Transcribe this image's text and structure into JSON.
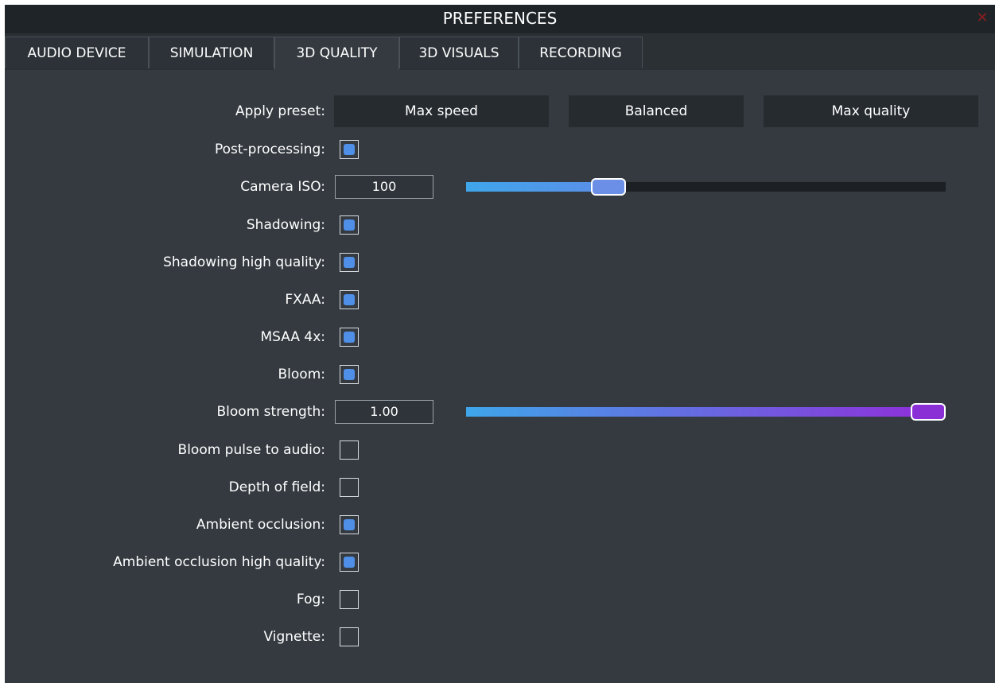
{
  "window": {
    "title": "PREFERENCES",
    "close_glyph": "✕"
  },
  "tabs": [
    {
      "label": "AUDIO DEVICE",
      "active": false
    },
    {
      "label": "SIMULATION",
      "active": false
    },
    {
      "label": "3D QUALITY",
      "active": true
    },
    {
      "label": "3D VISUALS",
      "active": false
    },
    {
      "label": "RECORDING",
      "active": false
    }
  ],
  "preset": {
    "label": "Apply preset:",
    "buttons": [
      "Max speed",
      "Balanced",
      "Max quality"
    ]
  },
  "settings": {
    "post_processing": {
      "label": "Post-processing:",
      "checked": true
    },
    "camera_iso": {
      "label": "Camera ISO:",
      "value": "100",
      "slider_fraction": 0.28
    },
    "shadowing": {
      "label": "Shadowing:",
      "checked": true
    },
    "shadowing_hq": {
      "label": "Shadowing high quality:",
      "checked": true
    },
    "fxaa": {
      "label": "FXAA:",
      "checked": true
    },
    "msaa": {
      "label": "MSAA 4x:",
      "checked": true
    },
    "bloom": {
      "label": "Bloom:",
      "checked": true
    },
    "bloom_strength": {
      "label": "Bloom strength:",
      "value": "1.00",
      "slider_fraction": 1.0
    },
    "bloom_pulse": {
      "label": "Bloom pulse to audio:",
      "checked": false
    },
    "depth_of_field": {
      "label": "Depth of field:",
      "checked": false
    },
    "ambient_occlusion": {
      "label": "Ambient occlusion:",
      "checked": true
    },
    "ambient_occlusion_hq": {
      "label": "Ambient occlusion high quality:",
      "checked": true
    },
    "fog": {
      "label": "Fog:",
      "checked": false
    },
    "vignette": {
      "label": "Vignette:",
      "checked": false
    }
  },
  "colors": {
    "checkbox_fill": "#4f8fe8",
    "iso_gradient_start": "#3fa6ea",
    "iso_gradient_end": "#5b8ee8",
    "bloom_gradient_start": "#3fa6ea",
    "bloom_gradient_end": "#8e2fd9",
    "iso_thumb": "#6b8fe6",
    "bloom_thumb": "#8a2fd6",
    "close": "#8a1f1f"
  }
}
